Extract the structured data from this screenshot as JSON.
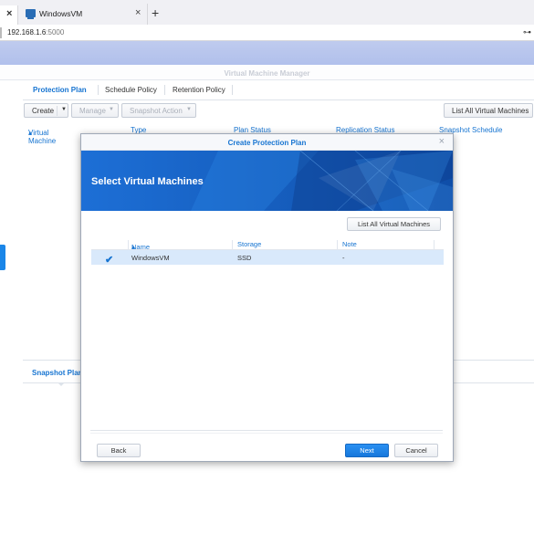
{
  "browser": {
    "prev_tab_close": "×",
    "tab_title": "WindowsVM",
    "tab_close": "×",
    "new_tab": "+",
    "url_host": "192.168.1.6",
    "url_port": ":5000",
    "key_icon": "⊶"
  },
  "app": {
    "title": "Virtual Machine Manager",
    "tabs": [
      "Protection Plan",
      "Schedule Policy",
      "Retention Policy"
    ],
    "toolbar": {
      "create": "Create",
      "manage": "Manage",
      "snapshot_action": "Snapshot Action",
      "list_all": "List All Virtual Machines"
    },
    "columns": [
      "Virtual Machine",
      "Type",
      "Plan Status",
      "Replication Status",
      "Snapshot Schedule"
    ],
    "sort_indicator": "▴",
    "snapshot_panel_label": "Snapshot Plan"
  },
  "dialog": {
    "title": "Create Protection Plan",
    "close": "×",
    "heading": "Select Virtual Machines",
    "list_all_button": "List All Virtual Machines",
    "columns": {
      "name": "Name",
      "storage": "Storage",
      "note": "Note"
    },
    "sort_indicator": "▴",
    "rows": [
      {
        "checked": "✔",
        "name": "WindowsVM",
        "storage": "SSD",
        "note": "-"
      }
    ],
    "buttons": {
      "back": "Back",
      "next": "Next",
      "cancel": "Cancel"
    }
  },
  "colors": {
    "accent": "#1674d1",
    "banner": "#1a5fbf",
    "selected_row": "#d9e9fb"
  }
}
